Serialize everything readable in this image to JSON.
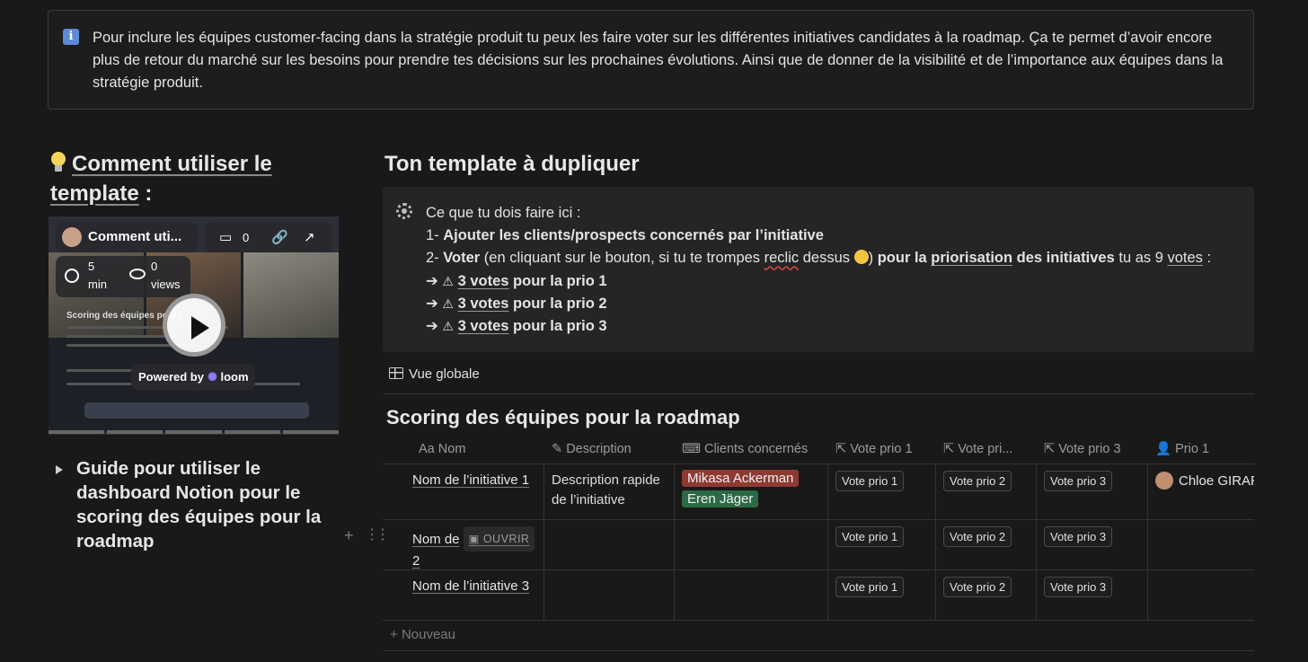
{
  "top_callout": {
    "icon": "info-icon",
    "text": "Pour inclure les équipes customer-facing dans la stratégie produit tu peux les faire voter sur les différentes initiatives candidates à la roadmap. Ça te permet d’avoir encore plus de retour du marché sur les besoins pour prendre tes décisions sur les prochaines évolutions. Ainsi que de donner de la visibilité et de l’importance aux équipes dans la stratégie produit."
  },
  "left": {
    "heading_link": "Comment utiliser le template",
    "heading_suffix": " :",
    "video": {
      "title": "Comment uti...",
      "comments": "0",
      "duration_value": "5",
      "duration_unit": "min",
      "views_value": "0",
      "views_unit": "views",
      "doc_title": "Scoring des équipes pour l",
      "powered_by": "Powered by",
      "brand": "loom"
    },
    "toggle_label": "Guide pour utiliser le dashboard Notion pour le scoring des équipes pour la roadmap"
  },
  "right": {
    "heading": "Ton template à dupliquer",
    "instructions": {
      "line1": "Ce que tu dois faire ici :",
      "line2_prefix": "1- ",
      "line2_bold": "Ajouter les clients/prospects concernés par l’initiative",
      "line3_prefix": "2- ",
      "line3_bold1": "Voter",
      "line3_mid1": " (en cliquant sur le bouton, si tu te trompes ",
      "line3_squig": "reclic",
      "line3_mid2": " dessus ",
      "line3_mid3": ") ",
      "line3_bold2a": "pour la ",
      "line3_bold2u": "priorisation",
      "line3_bold2b": " des initiatives",
      "line3_tail": " tu as 9 ",
      "line3_votes": "votes",
      "line3_colon": " :",
      "arrow": "➔ ",
      "prio_lines": [
        {
          "u": "3 votes",
          "rest": " pour la prio 1"
        },
        {
          "u": "3 votes",
          "rest": " pour la prio 2"
        },
        {
          "u": "3 votes",
          "rest": " pour la prio 3"
        }
      ]
    },
    "view_tab": "Vue globale",
    "db_title": "Scoring des équipes pour la roadmap",
    "columns": {
      "name": "Nom",
      "name_prefix": "Aa",
      "description": "Description",
      "clients": "Clients concernés",
      "vote1": "Vote prio 1",
      "vote2": "Vote pri...",
      "vote3": "Vote prio 3",
      "prio1": "Prio 1"
    },
    "rows": [
      {
        "name": "Nom de l’initiative 1",
        "description": "Description rapide de l’initiative",
        "clients": [
          "Mikasa Ackerman",
          "Eren Jäger"
        ],
        "v1": "Vote prio 1",
        "v2": "Vote prio 2",
        "v3": "Vote prio 3",
        "prio1": "Chloe GIRAR"
      },
      {
        "name_a": "Nom de",
        "name_b": "2",
        "open": "OUVRIR",
        "v1": "Vote prio 1",
        "v2": "Vote prio 2",
        "v3": "Vote prio 3"
      },
      {
        "name": "Nom de l’initiative 3",
        "v1": "Vote prio 1",
        "v2": "Vote prio 2",
        "v3": "Vote prio 3"
      }
    ],
    "new_row": "Nouveau",
    "tag_colors": {
      "red": "#8e3a32",
      "green": "#2b6a45"
    }
  }
}
